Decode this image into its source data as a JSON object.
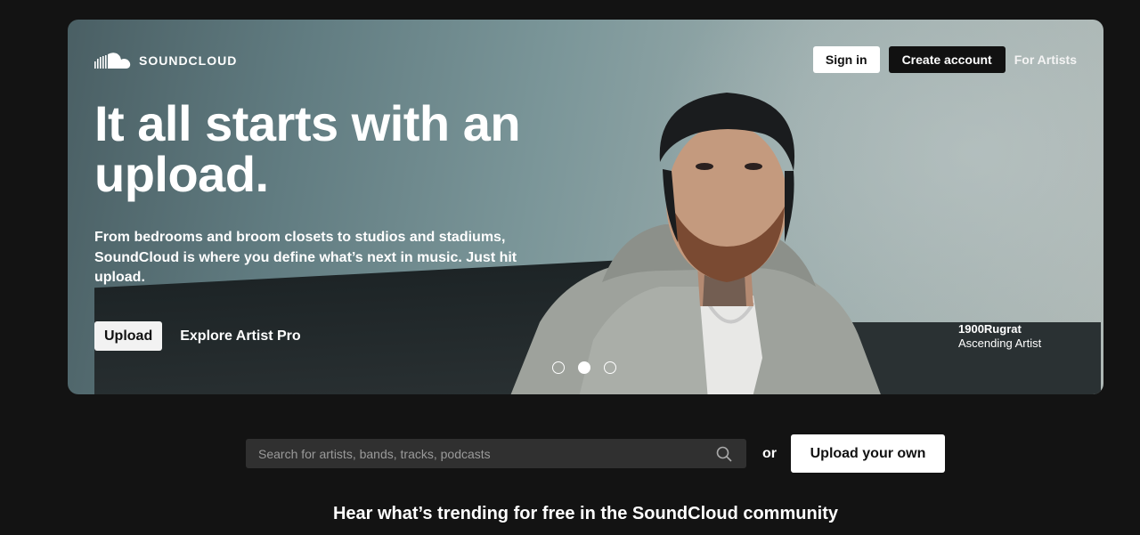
{
  "brand": {
    "name": "SOUNDCLOUD"
  },
  "nav": {
    "sign_in": "Sign in",
    "create_account": "Create account",
    "for_artists": "For Artists"
  },
  "hero": {
    "headline": "It all starts with an upload.",
    "subtext": "From bedrooms and broom closets to studios and stadiums, SoundCloud is where you define what’s next in music. Just hit upload.",
    "upload_button": "Upload",
    "explore_link": "Explore Artist Pro",
    "slides": {
      "count": 3,
      "active_index": 1
    },
    "credit": {
      "artist": "1900Rugrat",
      "caption": "Ascending Artist"
    }
  },
  "search": {
    "placeholder": "Search for artists, bands, tracks, podcasts",
    "value": "",
    "or_label": "or",
    "upload_own": "Upload your own"
  },
  "trending": {
    "heading": "Hear what’s trending for free in the SoundCloud community"
  },
  "colors": {
    "page_bg": "#131313",
    "search_bg": "#303030",
    "dark_button": "#111111"
  }
}
